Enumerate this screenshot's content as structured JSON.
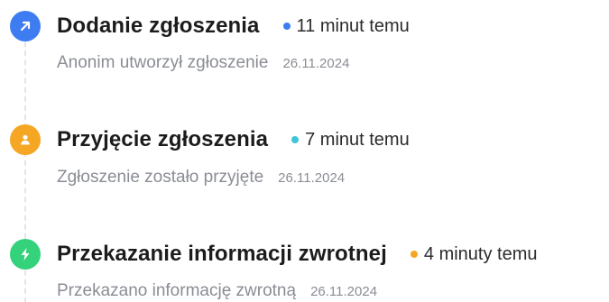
{
  "events": [
    {
      "title": "Dodanie zgłoszenia",
      "time": "11 minut temu",
      "description": "Anonim utworzył zgłoszenie",
      "date": "26.11.2024",
      "icon": "arrow-up-right-icon",
      "icon_color": "#3e7cf2",
      "status_color": "#3e7cf2"
    },
    {
      "title": "Przyjęcie zgłoszenia",
      "time": "7 minut temu",
      "description": "Zgłoszenie zostało przyjęte",
      "date": "26.11.2024",
      "icon": "user-icon",
      "icon_color": "#f5a623",
      "status_color": "#3ec5d8"
    },
    {
      "title": "Przekazanie informacji zwrotnej",
      "time": "4 minuty temu",
      "description": "Przekazano informację zwrotną",
      "date": "26.11.2024",
      "icon": "lightning-icon",
      "icon_color": "#34d27b",
      "status_color": "#f5a623"
    }
  ]
}
